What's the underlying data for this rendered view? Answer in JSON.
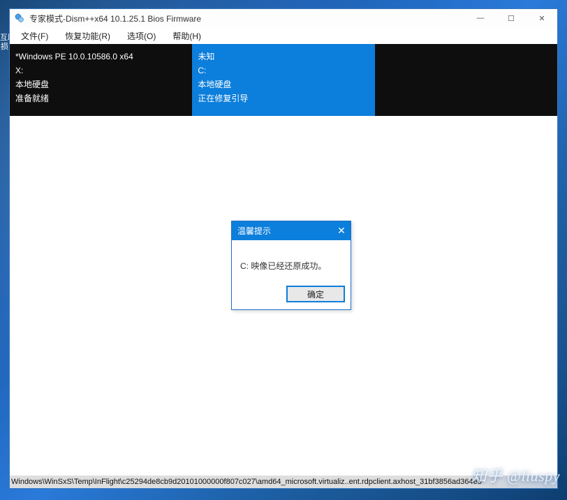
{
  "desktop_left_fragment": "互助\n损",
  "titlebar": {
    "title": "专家模式-Dism++x64 10.1.25.1 Bios Firmware"
  },
  "title_buttons": {
    "minimize": "—",
    "maximize": "☐",
    "close": "✕"
  },
  "menu": {
    "file": "文件(F)",
    "restore": "恢复功能(R)",
    "options": "选项(O)",
    "help": "帮助(H)"
  },
  "panels": {
    "left": {
      "line1": "*Windows PE 10.0.10586.0 x64",
      "line2": "X:",
      "line3": "本地硬盘",
      "line4": "准备就绪"
    },
    "middle": {
      "line1": "未知",
      "line2": "C:",
      "line3": "本地硬盘",
      "line4": "正在修复引导"
    }
  },
  "dialog": {
    "title": "温馨提示",
    "close": "✕",
    "message": "C: 映像已经还原成功。",
    "ok": "确定"
  },
  "statusbar": {
    "text": "Windows\\WinSxS\\Temp\\InFlight\\c25294de8cb9d20101000000f807c027\\amd64_microsoft.virtualiz..ent.rdpclient.axhost_31bf3856ad364e3"
  },
  "watermark": "知乎 @liuspy"
}
